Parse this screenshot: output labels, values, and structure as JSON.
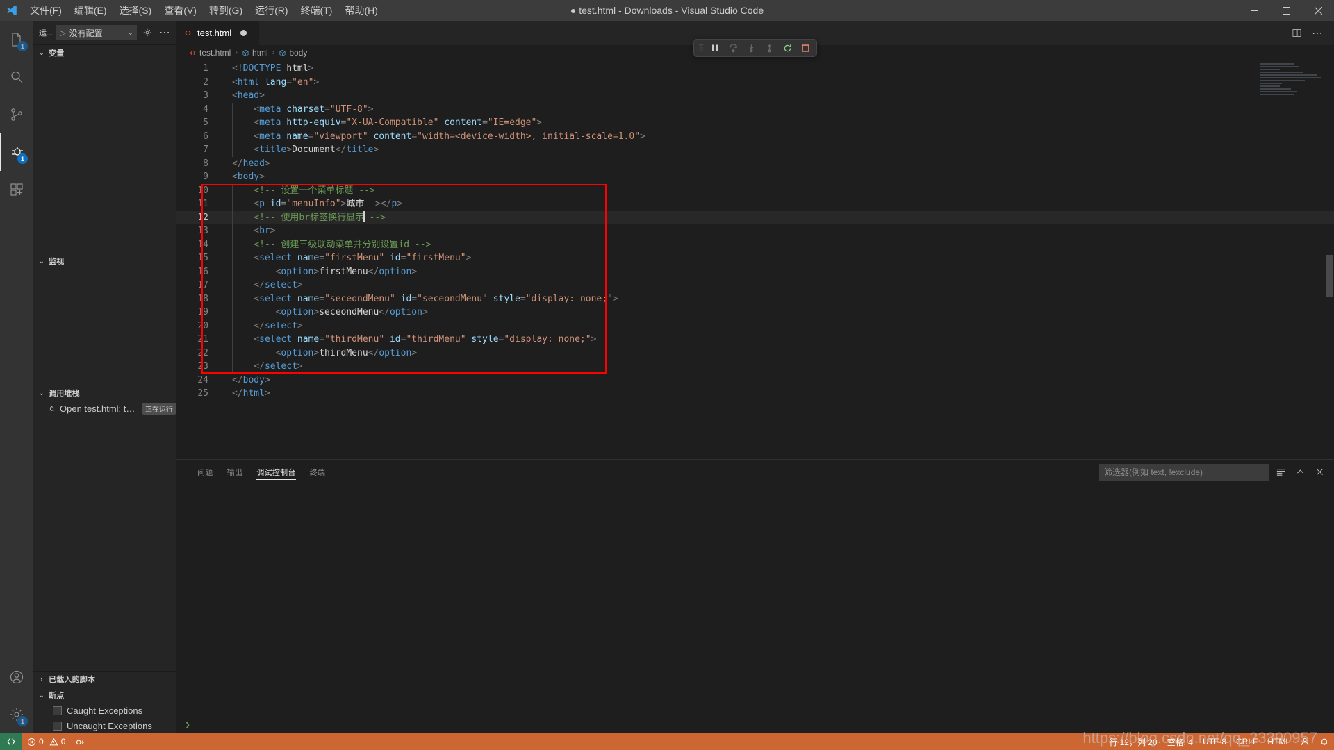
{
  "window": {
    "title": "● test.html - Downloads - Visual Studio Code",
    "minimize": "–",
    "maximize": "▢",
    "close": "✕"
  },
  "menu": {
    "items": [
      {
        "label": "文件(F)",
        "name": "menu-file"
      },
      {
        "label": "编辑(E)",
        "name": "menu-edit"
      },
      {
        "label": "选择(S)",
        "name": "menu-selection"
      },
      {
        "label": "查看(V)",
        "name": "menu-view"
      },
      {
        "label": "转到(G)",
        "name": "menu-go"
      },
      {
        "label": "运行(R)",
        "name": "menu-run"
      },
      {
        "label": "终端(T)",
        "name": "menu-terminal"
      },
      {
        "label": "帮助(H)",
        "name": "menu-help"
      }
    ]
  },
  "activitybar": {
    "items": [
      {
        "name": "explorer-icon",
        "badge": "1"
      },
      {
        "name": "search-icon",
        "badge": ""
      },
      {
        "name": "source-control-icon",
        "badge": ""
      },
      {
        "name": "run-and-debug-icon",
        "badge": "1"
      },
      {
        "name": "extensions-icon",
        "badge": ""
      }
    ],
    "bottom": [
      {
        "name": "accounts-icon",
        "badge": ""
      },
      {
        "name": "settings-gear-icon",
        "badge": "1"
      }
    ]
  },
  "debug_toolbar": {
    "run_label": "运...",
    "config_value": "没有配置",
    "play_glyph": "▷",
    "chevron": "⌄",
    "gear_title": "打开“launch.json”",
    "more_title": "更多操作..."
  },
  "debug_float": {
    "buttons": [
      {
        "name": "continue-button",
        "glyph": "⏸",
        "state": "pause"
      },
      {
        "name": "step-over-button",
        "glyph": "⤼",
        "state": "dim"
      },
      {
        "name": "step-into-button",
        "glyph": "↓",
        "state": "dim"
      },
      {
        "name": "step-out-button",
        "glyph": "↑",
        "state": "dim"
      },
      {
        "name": "restart-button",
        "glyph": "⟲",
        "state": "green"
      },
      {
        "name": "stop-button",
        "glyph": "◼",
        "state": "red"
      }
    ]
  },
  "sidebar": {
    "variables": {
      "title": "变量",
      "items": []
    },
    "watch": {
      "title": "监视",
      "items": []
    },
    "callstack": {
      "title": "调用堆栈",
      "rows": [
        {
          "label": "Open test.html: test.h...",
          "badge": "正在运行",
          "icon": "bug-icon"
        }
      ]
    },
    "loaded_scripts": {
      "title": "已载入的脚本"
    },
    "breakpoints": {
      "title": "断点",
      "items": [
        {
          "label": "Caught Exceptions",
          "checked": false
        },
        {
          "label": "Uncaught Exceptions",
          "checked": false
        }
      ]
    }
  },
  "editor": {
    "tab": {
      "label": "test.html",
      "icon": "html5-icon",
      "dirty": true
    },
    "tab_actions": [
      {
        "name": "split-editor-icon",
        "glyph": "▥"
      },
      {
        "name": "more-actions-icon",
        "glyph": "⋯"
      }
    ],
    "breadcrumb": [
      {
        "label": "test.html",
        "icon": "html5-icon"
      },
      {
        "label": "html",
        "icon": "tag-icon"
      },
      {
        "label": "body",
        "icon": "tag-icon"
      }
    ],
    "language": "HTML",
    "lines": [
      {
        "n": 1,
        "indent": 0,
        "tokens": [
          {
            "t": "punc",
            "v": "<"
          },
          {
            "t": "doc",
            "v": "!DOCTYPE"
          },
          {
            "t": "white",
            "v": " "
          },
          {
            "t": "txt",
            "v": "html"
          },
          {
            "t": "punc",
            "v": ">"
          }
        ]
      },
      {
        "n": 2,
        "indent": 0,
        "tokens": [
          {
            "t": "punc",
            "v": "<"
          },
          {
            "t": "name",
            "v": "html"
          },
          {
            "t": "white",
            "v": " "
          },
          {
            "t": "attr",
            "v": "lang"
          },
          {
            "t": "punc",
            "v": "="
          },
          {
            "t": "str",
            "v": "\"en\""
          },
          {
            "t": "punc",
            "v": ">"
          }
        ]
      },
      {
        "n": 3,
        "indent": 0,
        "tokens": [
          {
            "t": "punc",
            "v": "<"
          },
          {
            "t": "name",
            "v": "head"
          },
          {
            "t": "punc",
            "v": ">"
          }
        ]
      },
      {
        "n": 4,
        "indent": 1,
        "tokens": [
          {
            "t": "punc",
            "v": "<"
          },
          {
            "t": "name",
            "v": "meta"
          },
          {
            "t": "white",
            "v": " "
          },
          {
            "t": "attr",
            "v": "charset"
          },
          {
            "t": "punc",
            "v": "="
          },
          {
            "t": "str",
            "v": "\"UTF-8\""
          },
          {
            "t": "punc",
            "v": ">"
          }
        ]
      },
      {
        "n": 5,
        "indent": 1,
        "tokens": [
          {
            "t": "punc",
            "v": "<"
          },
          {
            "t": "name",
            "v": "meta"
          },
          {
            "t": "white",
            "v": " "
          },
          {
            "t": "attr",
            "v": "http-equiv"
          },
          {
            "t": "punc",
            "v": "="
          },
          {
            "t": "str",
            "v": "\"X-UA-Compatible\""
          },
          {
            "t": "white",
            "v": " "
          },
          {
            "t": "attr",
            "v": "content"
          },
          {
            "t": "punc",
            "v": "="
          },
          {
            "t": "str",
            "v": "\"IE=edge\""
          },
          {
            "t": "punc",
            "v": ">"
          }
        ]
      },
      {
        "n": 6,
        "indent": 1,
        "tokens": [
          {
            "t": "punc",
            "v": "<"
          },
          {
            "t": "name",
            "v": "meta"
          },
          {
            "t": "white",
            "v": " "
          },
          {
            "t": "attr",
            "v": "name"
          },
          {
            "t": "punc",
            "v": "="
          },
          {
            "t": "str",
            "v": "\"viewport\""
          },
          {
            "t": "white",
            "v": " "
          },
          {
            "t": "attr",
            "v": "content"
          },
          {
            "t": "punc",
            "v": "="
          },
          {
            "t": "str",
            "v": "\"width=<device-width>, initial-scale=1.0\""
          },
          {
            "t": "punc",
            "v": ">"
          }
        ]
      },
      {
        "n": 7,
        "indent": 1,
        "tokens": [
          {
            "t": "punc",
            "v": "<"
          },
          {
            "t": "name",
            "v": "title"
          },
          {
            "t": "punc",
            "v": ">"
          },
          {
            "t": "txt",
            "v": "Document"
          },
          {
            "t": "punc",
            "v": "</"
          },
          {
            "t": "name",
            "v": "title"
          },
          {
            "t": "punc",
            "v": ">"
          }
        ]
      },
      {
        "n": 8,
        "indent": 0,
        "tokens": [
          {
            "t": "punc",
            "v": "</"
          },
          {
            "t": "name",
            "v": "head"
          },
          {
            "t": "punc",
            "v": ">"
          }
        ]
      },
      {
        "n": 9,
        "indent": 0,
        "tokens": [
          {
            "t": "punc",
            "v": "<"
          },
          {
            "t": "name",
            "v": "body"
          },
          {
            "t": "punc",
            "v": ">"
          }
        ]
      },
      {
        "n": 10,
        "indent": 1,
        "tokens": [
          {
            "t": "com",
            "v": "<!-- 设置一个菜单标题 -->"
          }
        ]
      },
      {
        "n": 11,
        "indent": 1,
        "tokens": [
          {
            "t": "punc",
            "v": "<"
          },
          {
            "t": "name",
            "v": "p"
          },
          {
            "t": "white",
            "v": " "
          },
          {
            "t": "attr",
            "v": "id"
          },
          {
            "t": "punc",
            "v": "="
          },
          {
            "t": "str",
            "v": "\"menuInfo\""
          },
          {
            "t": "punc",
            "v": ">"
          },
          {
            "t": "txt",
            "v": "城市  "
          },
          {
            "t": "punc",
            "v": "></"
          },
          {
            "t": "name",
            "v": "p"
          },
          {
            "t": "punc",
            "v": ">"
          }
        ]
      },
      {
        "n": 12,
        "indent": 1,
        "current": true,
        "tokens": [
          {
            "t": "com",
            "v": "<!-- 使用br标签换行显示"
          },
          {
            "t": "caret",
            "v": ""
          },
          {
            "t": "com",
            "v": " -->"
          }
        ]
      },
      {
        "n": 13,
        "indent": 1,
        "tokens": [
          {
            "t": "punc",
            "v": "<"
          },
          {
            "t": "name",
            "v": "br"
          },
          {
            "t": "punc",
            "v": ">"
          }
        ]
      },
      {
        "n": 14,
        "indent": 1,
        "tokens": [
          {
            "t": "com",
            "v": "<!-- 创建三级联动菜单并分别设置id -->"
          }
        ]
      },
      {
        "n": 15,
        "indent": 1,
        "tokens": [
          {
            "t": "punc",
            "v": "<"
          },
          {
            "t": "name",
            "v": "select"
          },
          {
            "t": "white",
            "v": " "
          },
          {
            "t": "attr",
            "v": "name"
          },
          {
            "t": "punc",
            "v": "="
          },
          {
            "t": "str",
            "v": "\"firstMenu\""
          },
          {
            "t": "white",
            "v": " "
          },
          {
            "t": "attr",
            "v": "id"
          },
          {
            "t": "punc",
            "v": "="
          },
          {
            "t": "str",
            "v": "\"firstMenu\""
          },
          {
            "t": "punc",
            "v": ">"
          }
        ]
      },
      {
        "n": 16,
        "indent": 2,
        "tokens": [
          {
            "t": "punc",
            "v": "<"
          },
          {
            "t": "name",
            "v": "option"
          },
          {
            "t": "punc",
            "v": ">"
          },
          {
            "t": "txt",
            "v": "firstMenu"
          },
          {
            "t": "punc",
            "v": "</"
          },
          {
            "t": "name",
            "v": "option"
          },
          {
            "t": "punc",
            "v": ">"
          }
        ]
      },
      {
        "n": 17,
        "indent": 1,
        "tokens": [
          {
            "t": "punc",
            "v": "</"
          },
          {
            "t": "name",
            "v": "select"
          },
          {
            "t": "punc",
            "v": ">"
          }
        ]
      },
      {
        "n": 18,
        "indent": 1,
        "tokens": [
          {
            "t": "punc",
            "v": "<"
          },
          {
            "t": "name",
            "v": "select"
          },
          {
            "t": "white",
            "v": " "
          },
          {
            "t": "attr",
            "v": "name"
          },
          {
            "t": "punc",
            "v": "="
          },
          {
            "t": "str",
            "v": "\"seceondMenu\""
          },
          {
            "t": "white",
            "v": " "
          },
          {
            "t": "attr",
            "v": "id"
          },
          {
            "t": "punc",
            "v": "="
          },
          {
            "t": "str",
            "v": "\"seceondMenu\""
          },
          {
            "t": "white",
            "v": " "
          },
          {
            "t": "attr",
            "v": "style"
          },
          {
            "t": "punc",
            "v": "="
          },
          {
            "t": "str",
            "v": "\"display: none;\""
          },
          {
            "t": "punc",
            "v": ">"
          }
        ]
      },
      {
        "n": 19,
        "indent": 2,
        "tokens": [
          {
            "t": "punc",
            "v": "<"
          },
          {
            "t": "name",
            "v": "option"
          },
          {
            "t": "punc",
            "v": ">"
          },
          {
            "t": "txt",
            "v": "seceondMenu"
          },
          {
            "t": "punc",
            "v": "</"
          },
          {
            "t": "name",
            "v": "option"
          },
          {
            "t": "punc",
            "v": ">"
          }
        ]
      },
      {
        "n": 20,
        "indent": 1,
        "tokens": [
          {
            "t": "punc",
            "v": "</"
          },
          {
            "t": "name",
            "v": "select"
          },
          {
            "t": "punc",
            "v": ">"
          }
        ]
      },
      {
        "n": 21,
        "indent": 1,
        "tokens": [
          {
            "t": "punc",
            "v": "<"
          },
          {
            "t": "name",
            "v": "select"
          },
          {
            "t": "white",
            "v": " "
          },
          {
            "t": "attr",
            "v": "name"
          },
          {
            "t": "punc",
            "v": "="
          },
          {
            "t": "str",
            "v": "\"thirdMenu\""
          },
          {
            "t": "white",
            "v": " "
          },
          {
            "t": "attr",
            "v": "id"
          },
          {
            "t": "punc",
            "v": "="
          },
          {
            "t": "str",
            "v": "\"thirdMenu\""
          },
          {
            "t": "white",
            "v": " "
          },
          {
            "t": "attr",
            "v": "style"
          },
          {
            "t": "punc",
            "v": "="
          },
          {
            "t": "str",
            "v": "\"display: none;\""
          },
          {
            "t": "punc",
            "v": ">"
          }
        ]
      },
      {
        "n": 22,
        "indent": 2,
        "tokens": [
          {
            "t": "punc",
            "v": "<"
          },
          {
            "t": "name",
            "v": "option"
          },
          {
            "t": "punc",
            "v": ">"
          },
          {
            "t": "txt",
            "v": "thirdMenu"
          },
          {
            "t": "punc",
            "v": "</"
          },
          {
            "t": "name",
            "v": "option"
          },
          {
            "t": "punc",
            "v": ">"
          }
        ]
      },
      {
        "n": 23,
        "indent": 1,
        "tokens": [
          {
            "t": "punc",
            "v": "</"
          },
          {
            "t": "name",
            "v": "select"
          },
          {
            "t": "punc",
            "v": ">"
          }
        ]
      },
      {
        "n": 24,
        "indent": 0,
        "tokens": [
          {
            "t": "punc",
            "v": "</"
          },
          {
            "t": "name",
            "v": "body"
          },
          {
            "t": "punc",
            "v": ">"
          }
        ]
      },
      {
        "n": 25,
        "indent": 0,
        "tokens": [
          {
            "t": "punc",
            "v": "</"
          },
          {
            "t": "name",
            "v": "html"
          },
          {
            "t": "punc",
            "v": ">"
          }
        ]
      }
    ],
    "annotation": {
      "name": "red-highlight-rectangle",
      "color": "#fe0000",
      "from_line": 10,
      "to_line": 23
    }
  },
  "panel": {
    "tabs": [
      {
        "label": "问题",
        "active": false,
        "name": "tab-problems"
      },
      {
        "label": "输出",
        "active": false,
        "name": "tab-output"
      },
      {
        "label": "调试控制台",
        "active": true,
        "name": "tab-debug-console"
      },
      {
        "label": "终端",
        "active": false,
        "name": "tab-terminal"
      }
    ],
    "filter_placeholder": "筛选器(例如 text, !exclude)",
    "actions": [
      {
        "name": "clear-console-icon",
        "glyph": "≡"
      },
      {
        "name": "chevron-up-icon",
        "glyph": "⌃"
      },
      {
        "name": "close-panel-icon",
        "glyph": "✕"
      }
    ],
    "repl_prompt": "❯"
  },
  "statusbar": {
    "remote_icon": "remote-window-icon",
    "problems": {
      "errors": "0",
      "warnings": "0",
      "error_icon": "error-circle-icon",
      "warning_icon": "warning-triangle-icon"
    },
    "debug_icon": "debug-alt-icon",
    "right_items": [
      {
        "label": "行 12，列 20",
        "name": "editor-position"
      },
      {
        "label": "空格: 4",
        "name": "indentation"
      },
      {
        "label": "UTF-8",
        "name": "encoding"
      },
      {
        "label": "CRLF",
        "name": "eol"
      },
      {
        "label": "HTML",
        "name": "language-mode"
      },
      {
        "label": "☺",
        "name": "feedback-smiley-icon"
      },
      {
        "label": "🔔",
        "name": "notifications-bell-icon"
      }
    ],
    "accent_color": "#cc6633"
  },
  "watermark": "https://blog.csdn.net/qq_23390957"
}
